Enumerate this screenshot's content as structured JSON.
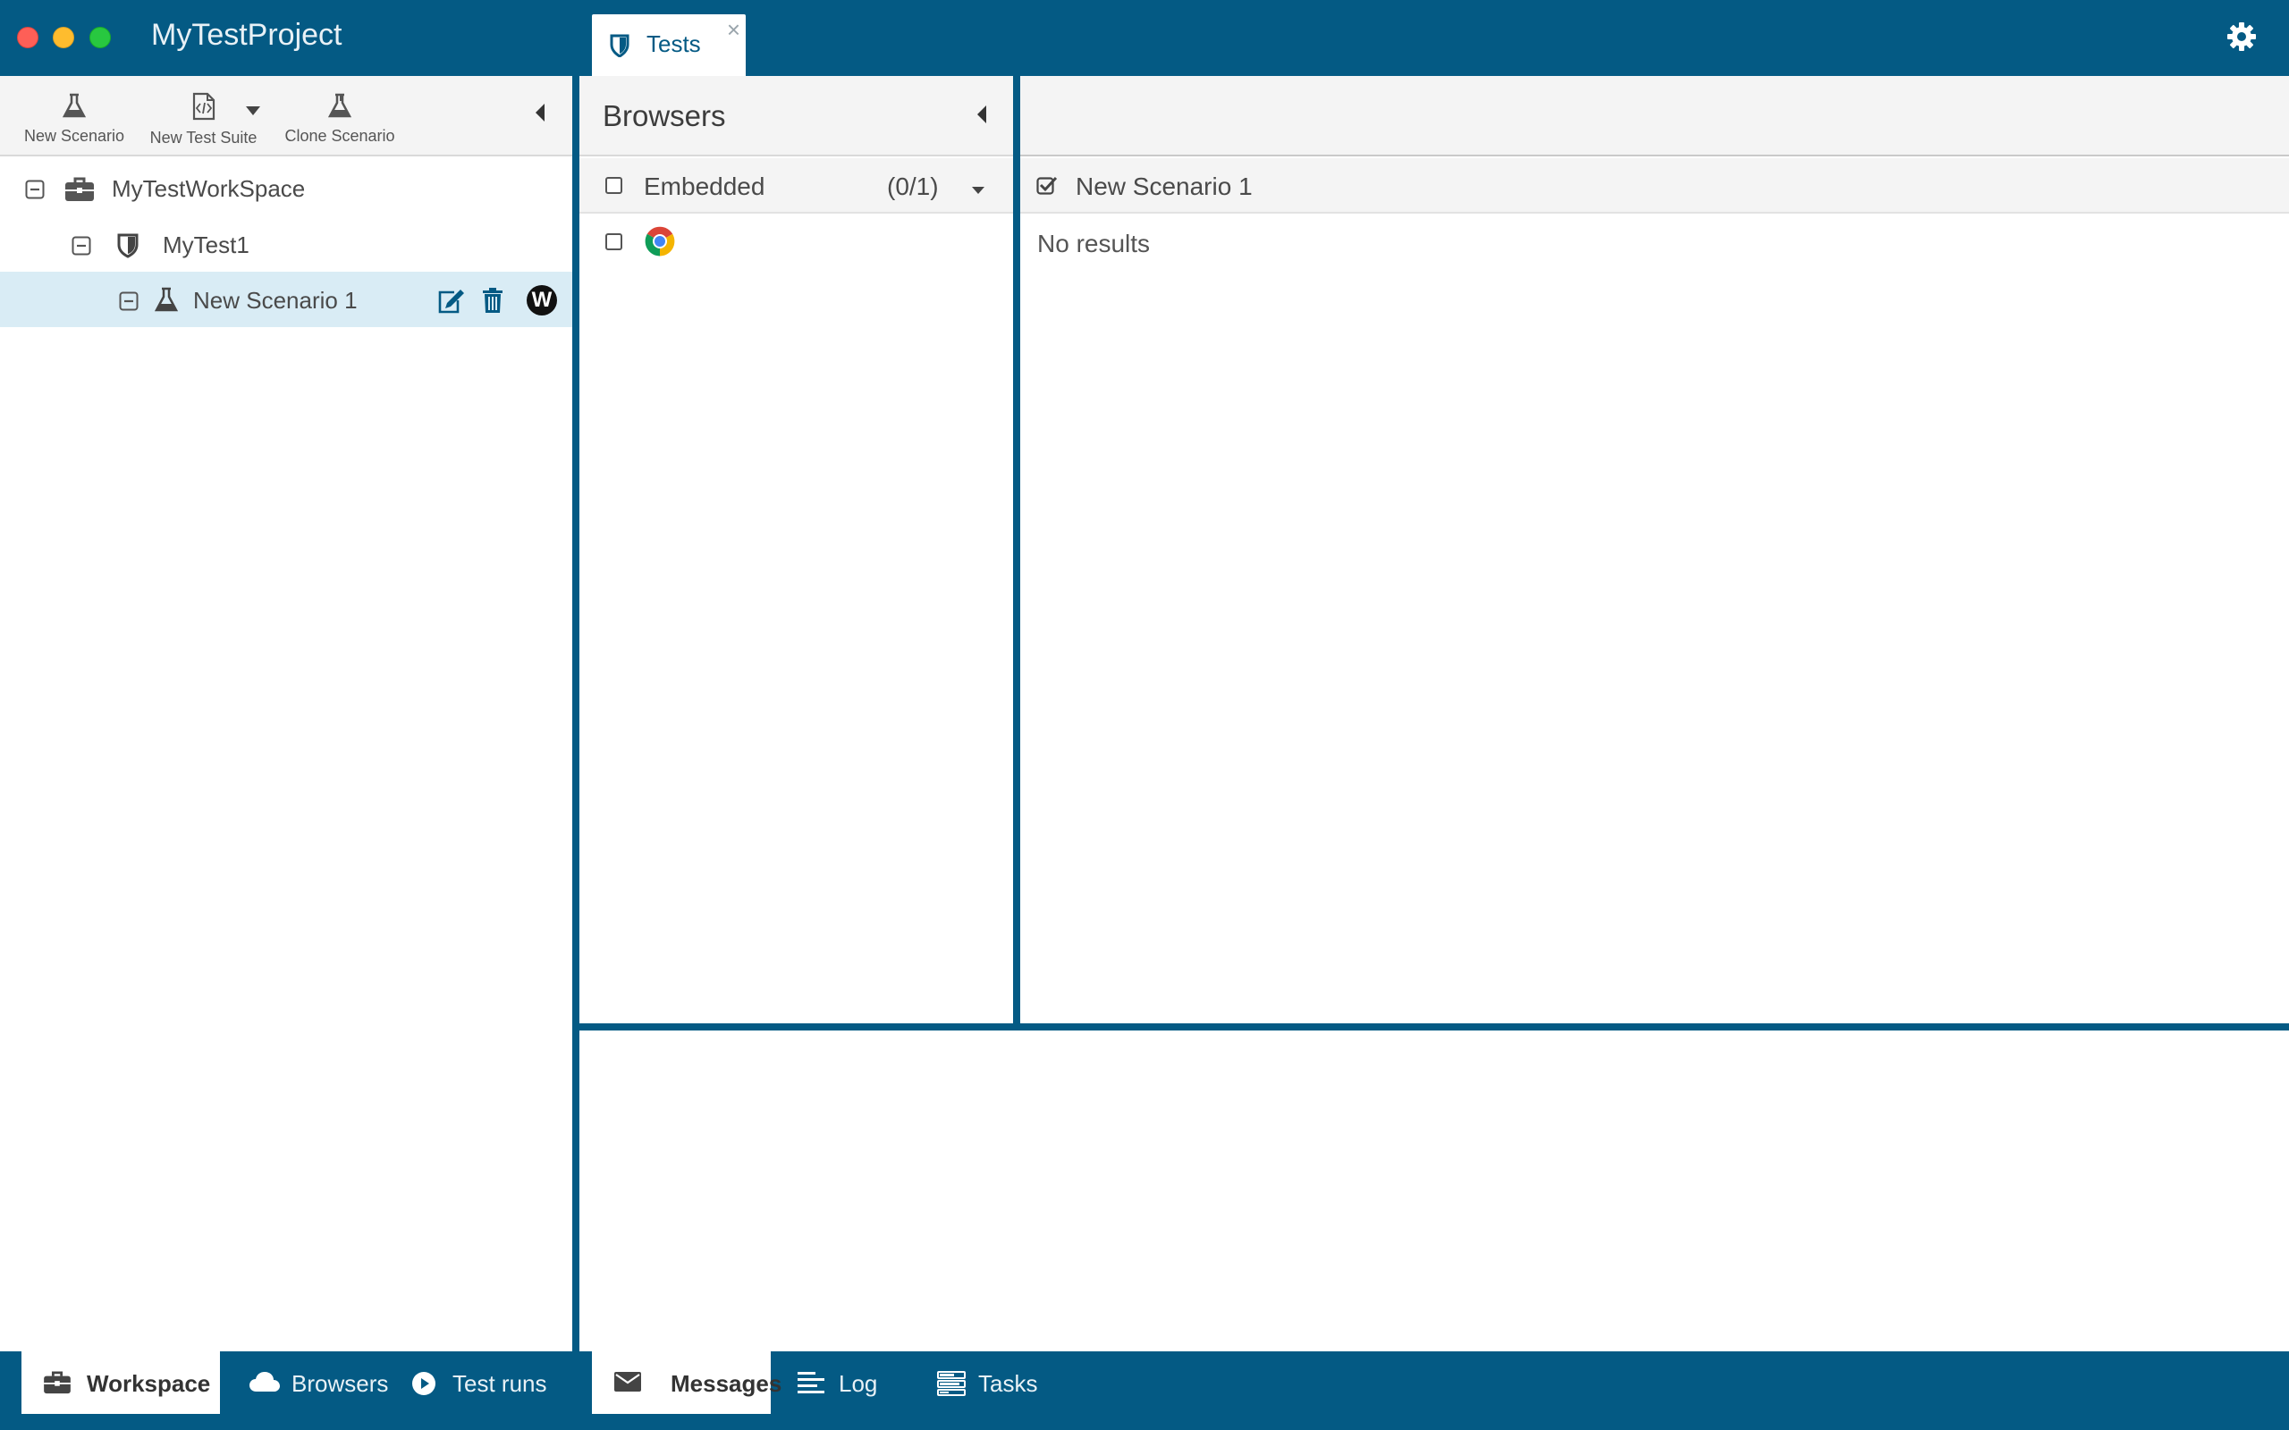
{
  "app": {
    "title": "MyTestProject"
  },
  "tabs": [
    {
      "label": "Tests",
      "close": "×"
    }
  ],
  "toolbar": {
    "new_scenario": "New Scenario",
    "new_test_suite": "New Test Suite",
    "clone_scenario": "Clone Scenario"
  },
  "tree": {
    "workspace": "MyTestWorkSpace",
    "suite": "MyTest1",
    "scenario": "New Scenario 1",
    "scenario_badge": "W"
  },
  "browsers": {
    "title": "Browsers",
    "group_label": "Embedded",
    "group_count": "(0/1)"
  },
  "results": {
    "scenario_title": "New Scenario 1",
    "empty_text": "No results"
  },
  "bottom_left_tabs": [
    "Workspace",
    "Browsers",
    "Test runs"
  ],
  "bottom_right_tabs": [
    "Messages",
    "Log",
    "Tasks"
  ],
  "colors": {
    "brand": "#045a84",
    "selected_row": "#d9ecf5",
    "panel_header": "#f4f4f4"
  }
}
